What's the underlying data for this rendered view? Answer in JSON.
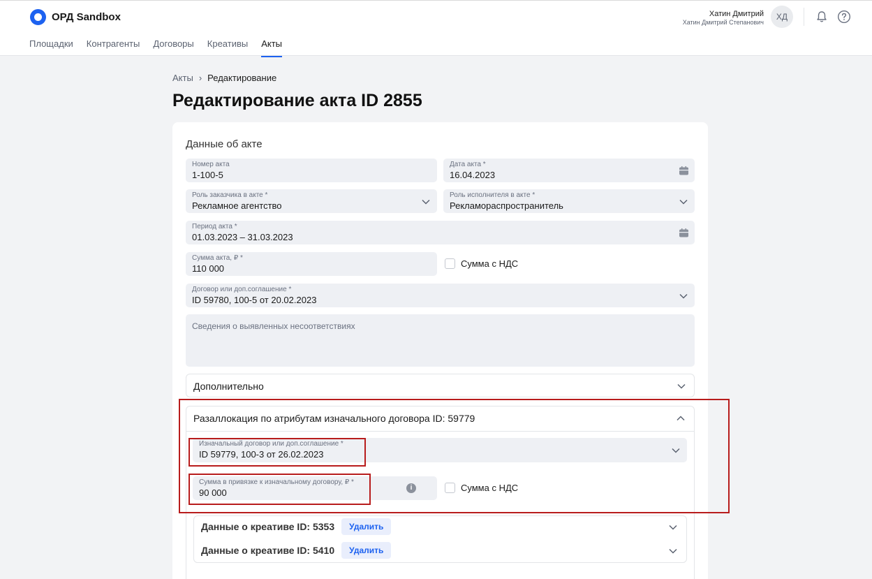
{
  "app": {
    "title": "ОРД Sandbox"
  },
  "nav": {
    "items": [
      "Площадки",
      "Контрагенты",
      "Договоры",
      "Креативы",
      "Акты"
    ],
    "active": "Акты"
  },
  "user": {
    "name": "Хатин Дмитрий",
    "full_name": "Хатин Дмитрий Степанович",
    "initials": "ХД"
  },
  "breadcrumb": {
    "parent": "Акты",
    "current": "Редактирование"
  },
  "page": {
    "title": "Редактирование акта ID 2855"
  },
  "act": {
    "section_title": "Данные об акте",
    "number": {
      "label": "Номер акта",
      "value": "1-100-5"
    },
    "date": {
      "label": "Дата акта *",
      "value": "16.04.2023"
    },
    "customer_role": {
      "label": "Роль заказчика в акте *",
      "value": "Рекламное агентство"
    },
    "contractor_role": {
      "label": "Роль исполнителя в акте *",
      "value": "Рекламораспространитель"
    },
    "period": {
      "label": "Период акта *",
      "value": "01.03.2023 – 31.03.2023"
    },
    "amount": {
      "label": "Сумма акта, ₽ *",
      "value": "110 000"
    },
    "vat_label": "Сумма с НДС",
    "contract": {
      "label": "Договор или доп.соглашение *",
      "value": "ID 59780, 100-5 от 20.02.2023"
    },
    "discrepancies_placeholder": "Сведения о выявленных несоответствиях"
  },
  "additional": {
    "title": "Дополнительно"
  },
  "reallocation": {
    "title": "Разаллокация по атрибутам изначального договора ID: 59779",
    "contract": {
      "label": "Изначальный договор или доп.соглашение *",
      "value": "ID 59779, 100-3 от 26.02.2023"
    },
    "amount": {
      "label": "Сумма в привязке к изначальному договору, ₽ *",
      "value": "90 000"
    },
    "vat_label": "Сумма с НДС",
    "info_icon": "i"
  },
  "creatives": [
    {
      "title": "Данные о креативе ID: 5353",
      "delete_label": "Удалить"
    },
    {
      "title": "Данные о креативе ID: 5410",
      "delete_label": "Удалить"
    }
  ],
  "colors": {
    "accent": "#1d62f0",
    "highlight": "#b81c1c",
    "field_bg": "#eef0f4"
  }
}
